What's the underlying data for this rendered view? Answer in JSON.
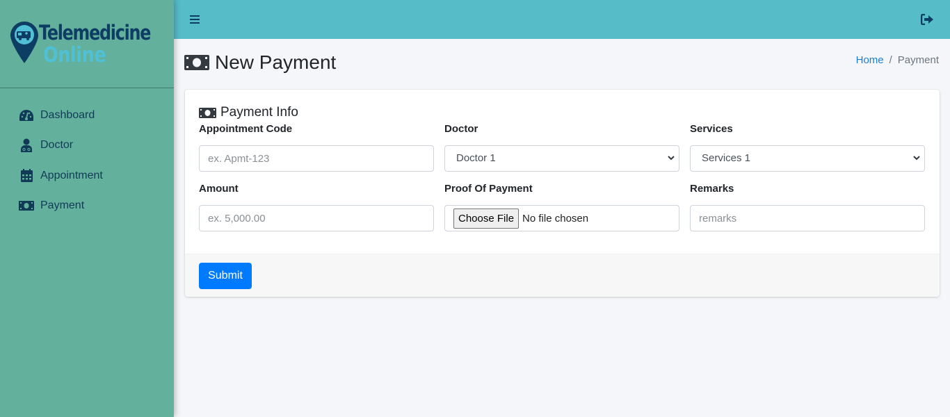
{
  "brand": {
    "line1": "Telemedicine",
    "line2": "Online",
    "icon": "ambulance-pin-icon"
  },
  "colors": {
    "sidebar": "#63b19d",
    "topbar": "#56bcc8",
    "brand_dark": "#0e3d63",
    "brand_light": "#4fc0d6",
    "primary": "#007bff",
    "link": "#1b7fd1"
  },
  "sidebar": {
    "items": [
      {
        "label": "Dashboard",
        "icon": "tachometer-icon"
      },
      {
        "label": "Doctor",
        "icon": "user-doctor-icon"
      },
      {
        "label": "Appointment",
        "icon": "calendar-icon"
      },
      {
        "label": "Payment",
        "icon": "money-bill-icon"
      }
    ]
  },
  "topbar": {
    "menu_icon": "hamburger-icon",
    "logout_icon": "sign-out-icon"
  },
  "page": {
    "title": "New Payment",
    "title_icon": "money-bill-icon",
    "breadcrumb": {
      "home": "Home",
      "separator": "/",
      "current": "Payment"
    }
  },
  "form": {
    "title": "Payment Info",
    "fields": {
      "appointment_code": {
        "label": "Appointment Code",
        "placeholder": "ex. Apmt-123",
        "value": ""
      },
      "doctor": {
        "label": "Doctor",
        "selected": "Doctor 1"
      },
      "services": {
        "label": "Services",
        "selected": "Services 1"
      },
      "amount": {
        "label": "Amount",
        "placeholder": "ex. 5,000.00",
        "value": ""
      },
      "proof": {
        "label": "Proof Of Payment",
        "button": "Choose File",
        "status": "No file chosen"
      },
      "remarks": {
        "label": "Remarks",
        "placeholder": "remarks",
        "value": ""
      }
    },
    "submit_label": "Submit"
  }
}
